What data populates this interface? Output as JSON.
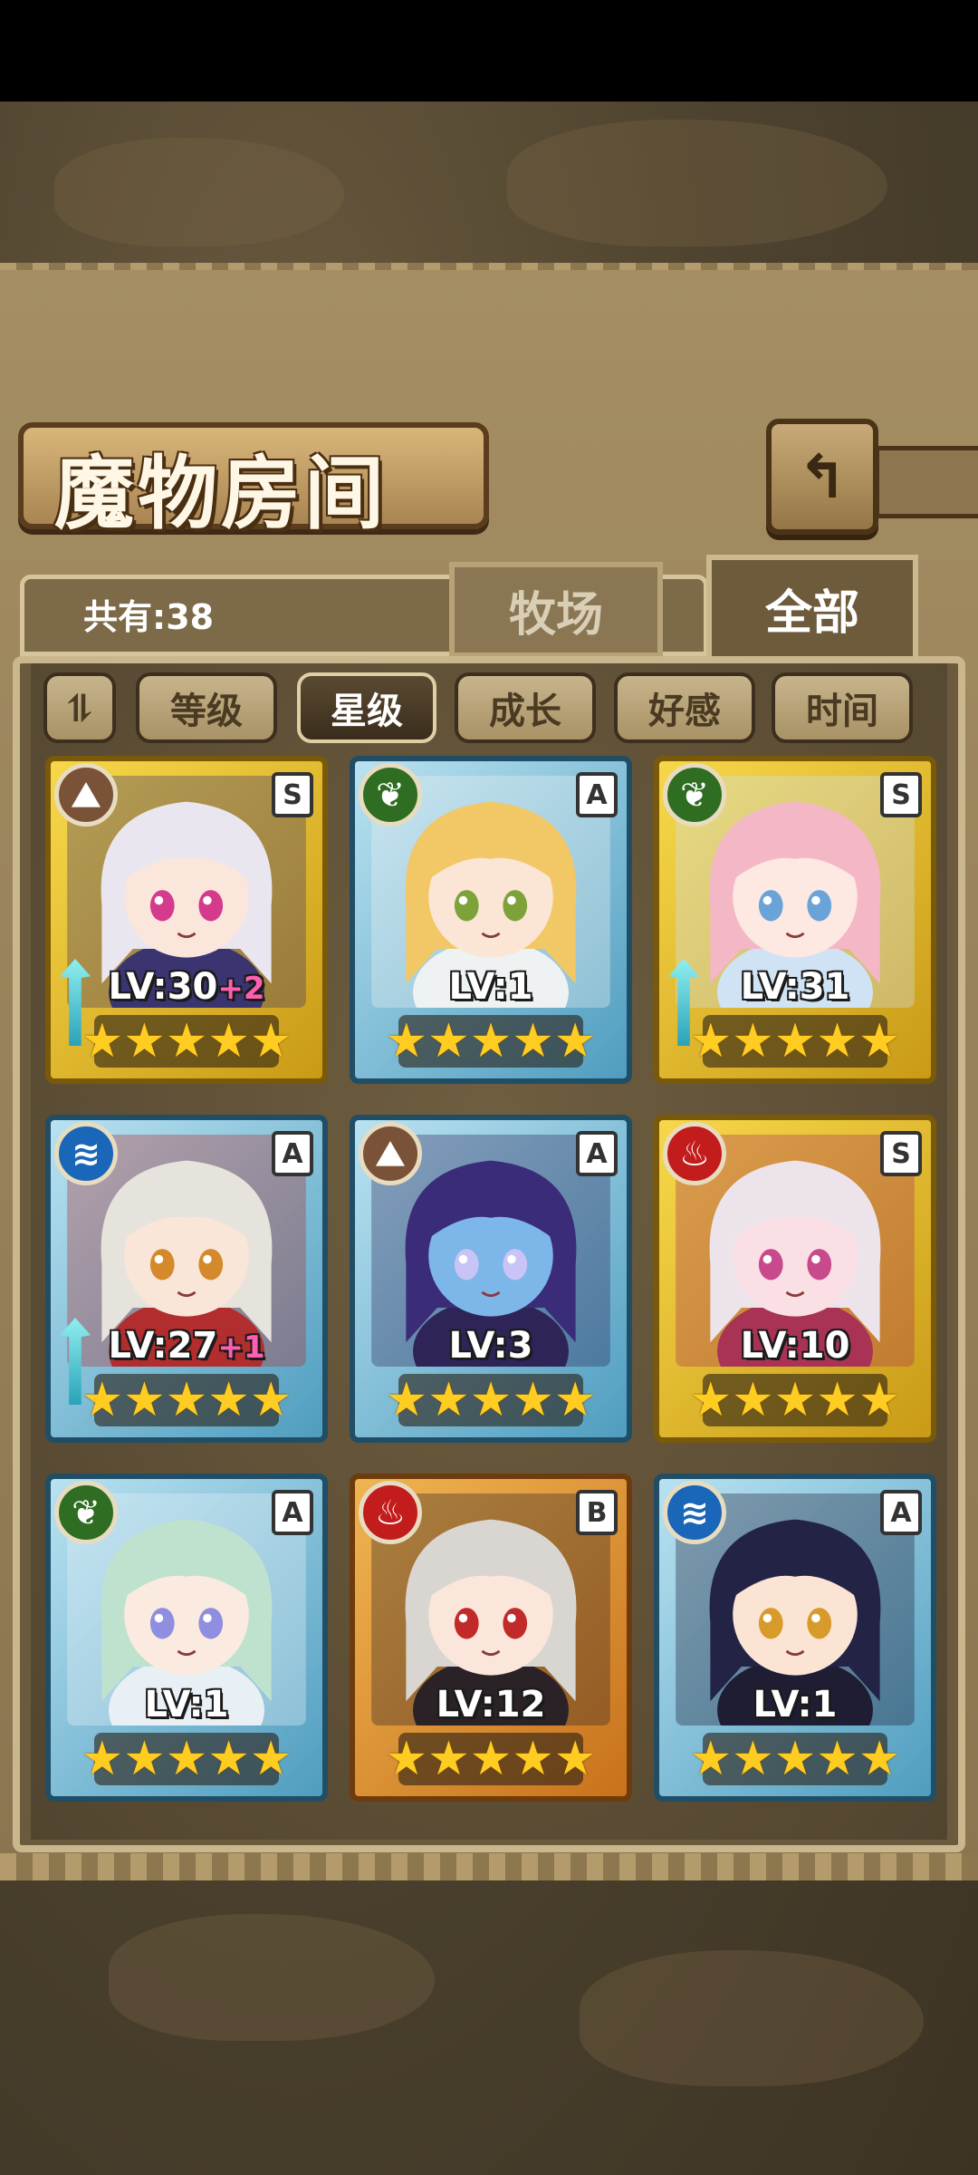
{
  "header": {
    "title": "魔物房间",
    "back_icon": "↰"
  },
  "info": {
    "count_label": "共有:38"
  },
  "tabs": [
    {
      "label": "牧场"
    },
    {
      "label": "全部",
      "active": true
    }
  ],
  "sort": {
    "toggle_icon": "⥮",
    "buttons": [
      {
        "label": "等级"
      },
      {
        "label": "星级",
        "active": true
      },
      {
        "label": "成长"
      },
      {
        "label": "好感"
      },
      {
        "label": "时间"
      }
    ]
  },
  "cards": [
    {
      "level": "LV:30",
      "bonus": "+2",
      "rank": "S",
      "element": "earth",
      "element_icon": "⛰",
      "frame": "gold",
      "stars": "★★★★★",
      "weapon": true
    },
    {
      "level": "LV:1",
      "bonus": "",
      "rank": "A",
      "element": "nature",
      "element_icon": "❦",
      "frame": "blue",
      "stars": "★★★★★",
      "weapon": false
    },
    {
      "level": "LV:31",
      "bonus": "",
      "rank": "S",
      "element": "nature",
      "element_icon": "❦",
      "frame": "gold",
      "stars": "★★★★★",
      "weapon": true
    },
    {
      "level": "LV:27",
      "bonus": "+1",
      "rank": "A",
      "element": "water",
      "element_icon": "≋",
      "frame": "blue",
      "stars": "★★★★★",
      "weapon": true
    },
    {
      "level": "LV:3",
      "bonus": "",
      "rank": "A",
      "element": "earth",
      "element_icon": "⛰",
      "frame": "blue",
      "stars": "★★★★★",
      "weapon": false
    },
    {
      "level": "LV:10",
      "bonus": "",
      "rank": "S",
      "element": "fire",
      "element_icon": "♨",
      "frame": "gold",
      "stars": "★★★★★",
      "weapon": false
    },
    {
      "level": "LV:1",
      "bonus": "",
      "rank": "A",
      "element": "nature",
      "element_icon": "❦",
      "frame": "blue",
      "stars": "★★★★★",
      "weapon": false
    },
    {
      "level": "LV:12",
      "bonus": "",
      "rank": "B",
      "element": "fire",
      "element_icon": "♨",
      "frame": "orange",
      "stars": "★★★★★",
      "weapon": false
    },
    {
      "level": "LV:1",
      "bonus": "",
      "rank": "A",
      "element": "water",
      "element_icon": "≋",
      "frame": "blue",
      "stars": "★★★★★",
      "weapon": false
    }
  ],
  "portraits": [
    {
      "hair": "#e9e6f0",
      "skin": "#fbe6dc",
      "eyes": "#d43b8c",
      "cloth": "#3a3470"
    },
    {
      "hair": "#f2c766",
      "skin": "#fbe6d6",
      "eyes": "#7ea23a",
      "cloth": "#eef2f2"
    },
    {
      "hair": "#f4b7c6",
      "skin": "#fde8e2",
      "eyes": "#6aa3d8",
      "cloth": "#cfe3f5"
    },
    {
      "hair": "#e6e2dc",
      "skin": "#fae6d8",
      "eyes": "#d48a2a",
      "cloth": "#b22d2d"
    },
    {
      "hair": "#3b2c7a",
      "skin": "#7db6e8",
      "eyes": "#c8c4f5",
      "cloth": "#2e2458"
    },
    {
      "hair": "#ece4ea",
      "skin": "#fae0e4",
      "eyes": "#c84a8c",
      "cloth": "#a83355"
    },
    {
      "hair": "#bfe2cf",
      "skin": "#fbeadf",
      "eyes": "#8f8ee0",
      "cloth": "#e8f0f6"
    },
    {
      "hair": "#d9d6d2",
      "skin": "#fae6da",
      "eyes": "#c22a2a",
      "cloth": "#2a2226"
    },
    {
      "hair": "#232445",
      "skin": "#fbe4d3",
      "eyes": "#d89a2a",
      "cloth": "#1f1d34"
    }
  ]
}
